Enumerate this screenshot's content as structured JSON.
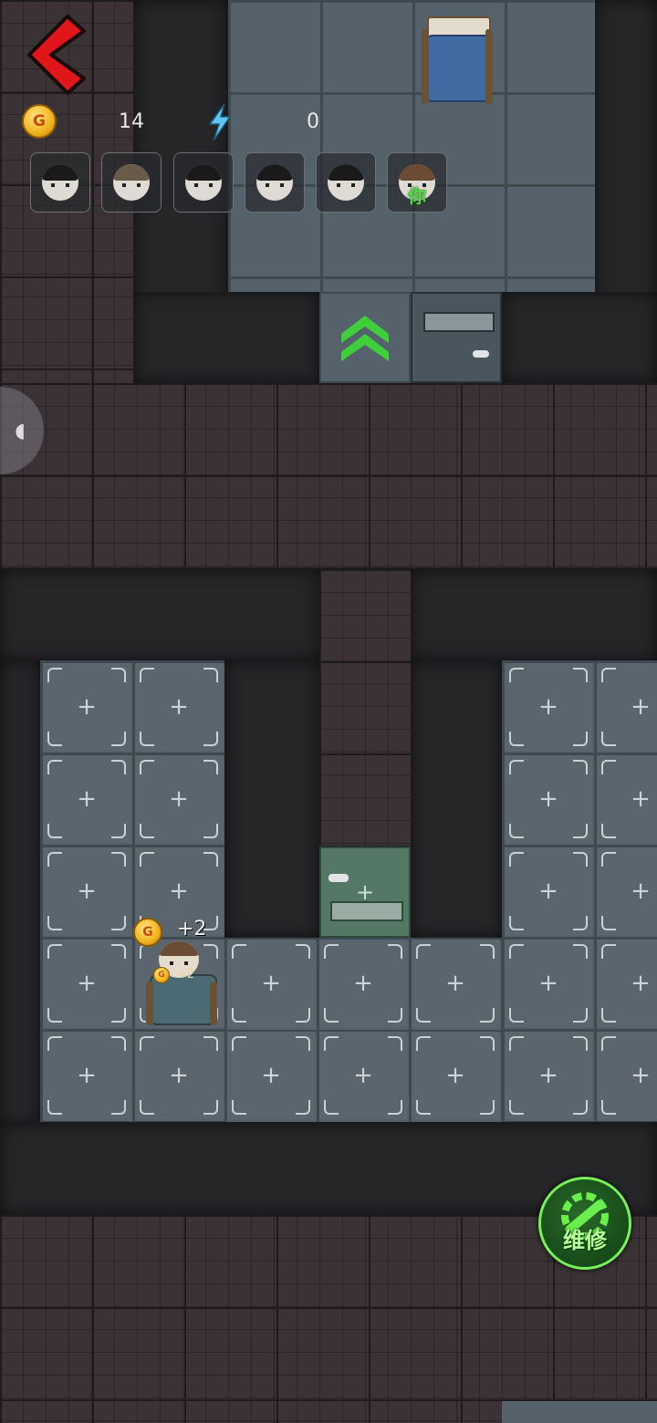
{
  "hud": {
    "coins": "14",
    "energy": "0",
    "coin_letter": "G"
  },
  "players": [
    {
      "name": "player-1",
      "hair": "#1a1a1a"
    },
    {
      "name": "player-2",
      "hair": "#6a5a4a"
    },
    {
      "name": "player-3",
      "hair": "#1a1a1a"
    },
    {
      "name": "player-4",
      "hair": "#1a1a1a"
    },
    {
      "name": "player-5",
      "hair": "#1a1a1a"
    },
    {
      "name": "player-6-you",
      "hair": "#6b4b33"
    }
  ],
  "you_label": "你",
  "repair_label": "维修",
  "bed_gain": {
    "main": "+2",
    "small": "+2"
  },
  "colors": {
    "accent_green": "#4ce03f",
    "back_red": "#e0161b",
    "energy_blue": "#5ec6f2",
    "coin_gold": "#f1b21c"
  },
  "slot_plus": "+"
}
